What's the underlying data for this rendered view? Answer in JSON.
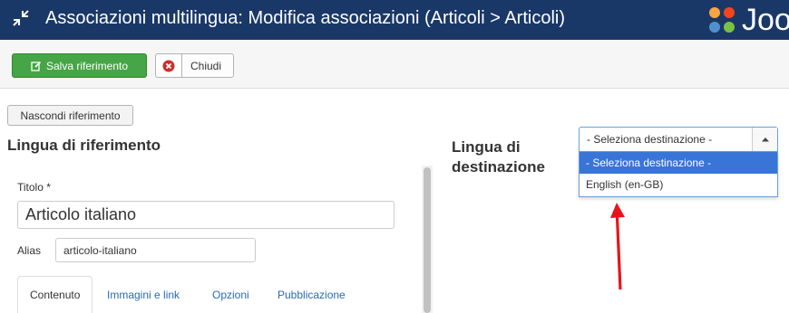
{
  "header": {
    "title": "Associazioni multilingua: Modifica associazioni (Articoli > Articoli)",
    "logo_text": "Joo",
    "bg_color": "#1a3867"
  },
  "toolbar": {
    "save_label": "Salva riferimento",
    "close_label": "Chiudi",
    "save_icon": "edit-icon",
    "close_icon": "close-circle-icon"
  },
  "main": {
    "hide_button_label": "Nascondi riferimento",
    "reference_heading": "Lingua di riferimento",
    "title_label": "Titolo *",
    "title_value": "Articolo italiano",
    "alias_label": "Alias",
    "alias_value": "articolo-italiano",
    "tabs": [
      {
        "label": "Contenuto",
        "active": true
      },
      {
        "label": "Immagini e link",
        "active": false
      },
      {
        "label": "Opzioni",
        "active": false
      },
      {
        "label": "Pubblicazione",
        "active": false
      }
    ]
  },
  "target": {
    "heading": "Lingua di destinazione",
    "select_value": "- Seleziona destinazione -",
    "options": [
      {
        "label": "- Seleziona destinazione -",
        "selected": true
      },
      {
        "label": "English (en-GB)",
        "selected": false
      }
    ]
  },
  "annotation": {
    "arrow_color": "#e8141b"
  }
}
